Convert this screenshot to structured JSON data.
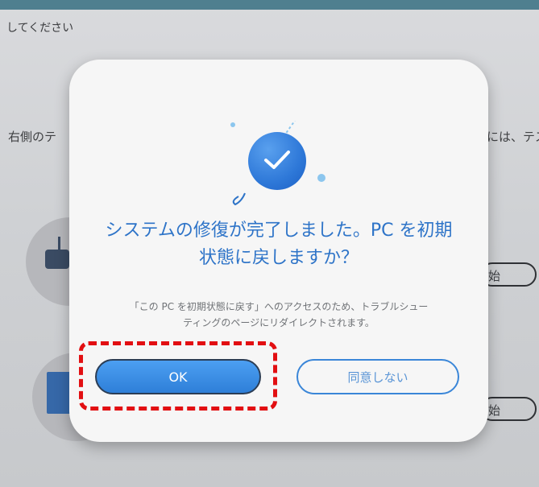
{
  "background": {
    "instruction_text": "してください",
    "left_text": "右側のテ",
    "right_text": "には、テス",
    "pill_1_label": "始",
    "pill_2_label": "始"
  },
  "dialog": {
    "title_line1": "システムの修復が完了しました。PC を初期",
    "title_line2": "状態に戻しますか？",
    "description_line1": "「この PC を初期状態に戻す」へのアクセスのため、トラブルシュー",
    "description_line2": "ティングのページにリダイレクトされます。",
    "ok_label": "OK",
    "disagree_label": "同意しない"
  },
  "colors": {
    "accent_blue": "#2e74c8",
    "highlight_red": "#e20f12"
  },
  "icons": {
    "success": "check-circle-icon"
  }
}
